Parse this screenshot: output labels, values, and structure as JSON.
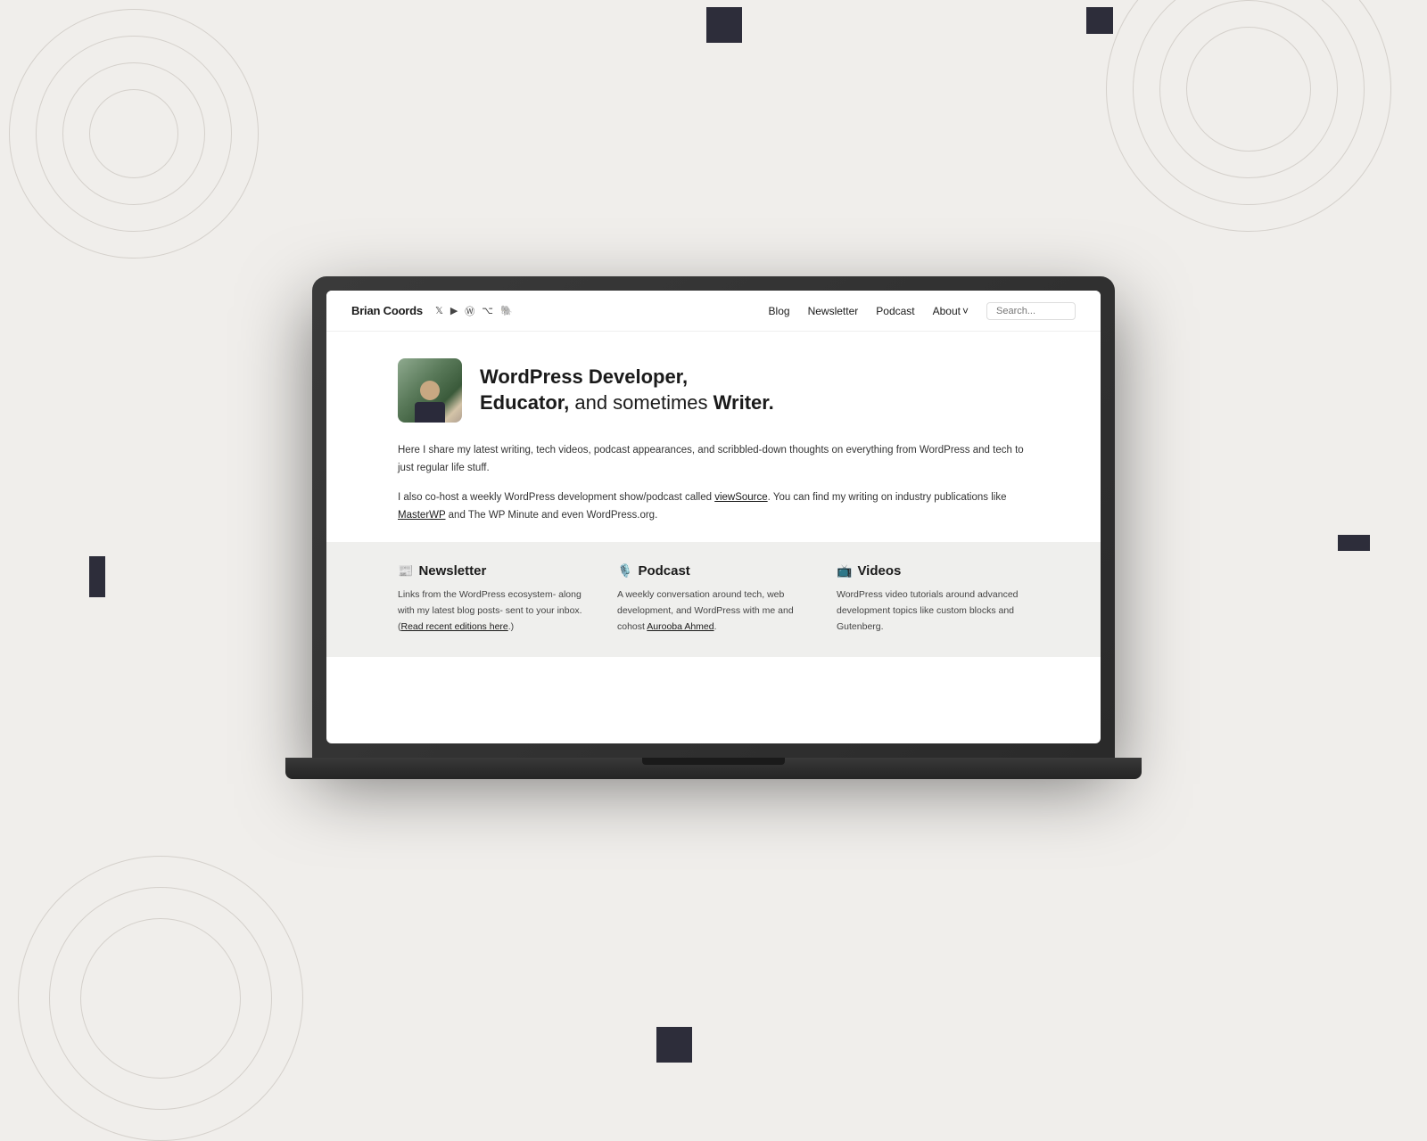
{
  "background": {
    "color": "#f0eeeb"
  },
  "navbar": {
    "site_title": "Brian Coords",
    "icons": [
      "twitter",
      "youtube",
      "wordpress",
      "github",
      "mastodon"
    ],
    "links": [
      {
        "label": "Blog",
        "name": "blog-link"
      },
      {
        "label": "Newsletter",
        "name": "newsletter-link"
      },
      {
        "label": "Podcast",
        "name": "podcast-link"
      },
      {
        "label": "About ˅",
        "name": "about-link"
      }
    ],
    "search_placeholder": "Search..."
  },
  "hero": {
    "headline_part1": "WordPress Developer,",
    "headline_part2": "Educator,",
    "headline_part3": " and sometimes ",
    "headline_part4": "Writer."
  },
  "description": {
    "text1": "Here I share my latest writing, tech videos, podcast appearances, and scribbled-down thoughts on everything from WordPress and tech to just regular life stuff.",
    "text2": "I also co-host a weekly WordPress development show/podcast called ",
    "viewsource_link": "viewSource",
    "text3": ". You can find my writing on industry publications like ",
    "masterwp_link": "MasterWP",
    "text4": " and The WP Minute and even WordPress.org."
  },
  "cards": [
    {
      "emoji": "📰",
      "title": "Newsletter",
      "description": "Links from the WordPress ecosystem- along with my latest blog posts- sent to your inbox. (",
      "link_text": "Read recent editions here",
      "description_end": ".)"
    },
    {
      "emoji": "🎙️",
      "title": "Podcast",
      "description": "A weekly conversation around tech, web development, and WordPress with me and cohost ",
      "link_text": "Aurooba Ahmed",
      "description_end": "."
    },
    {
      "emoji": "📺",
      "title": "Videos",
      "description": "WordPress video tutorials around advanced development topics like custom blocks and Gutenberg."
    }
  ]
}
